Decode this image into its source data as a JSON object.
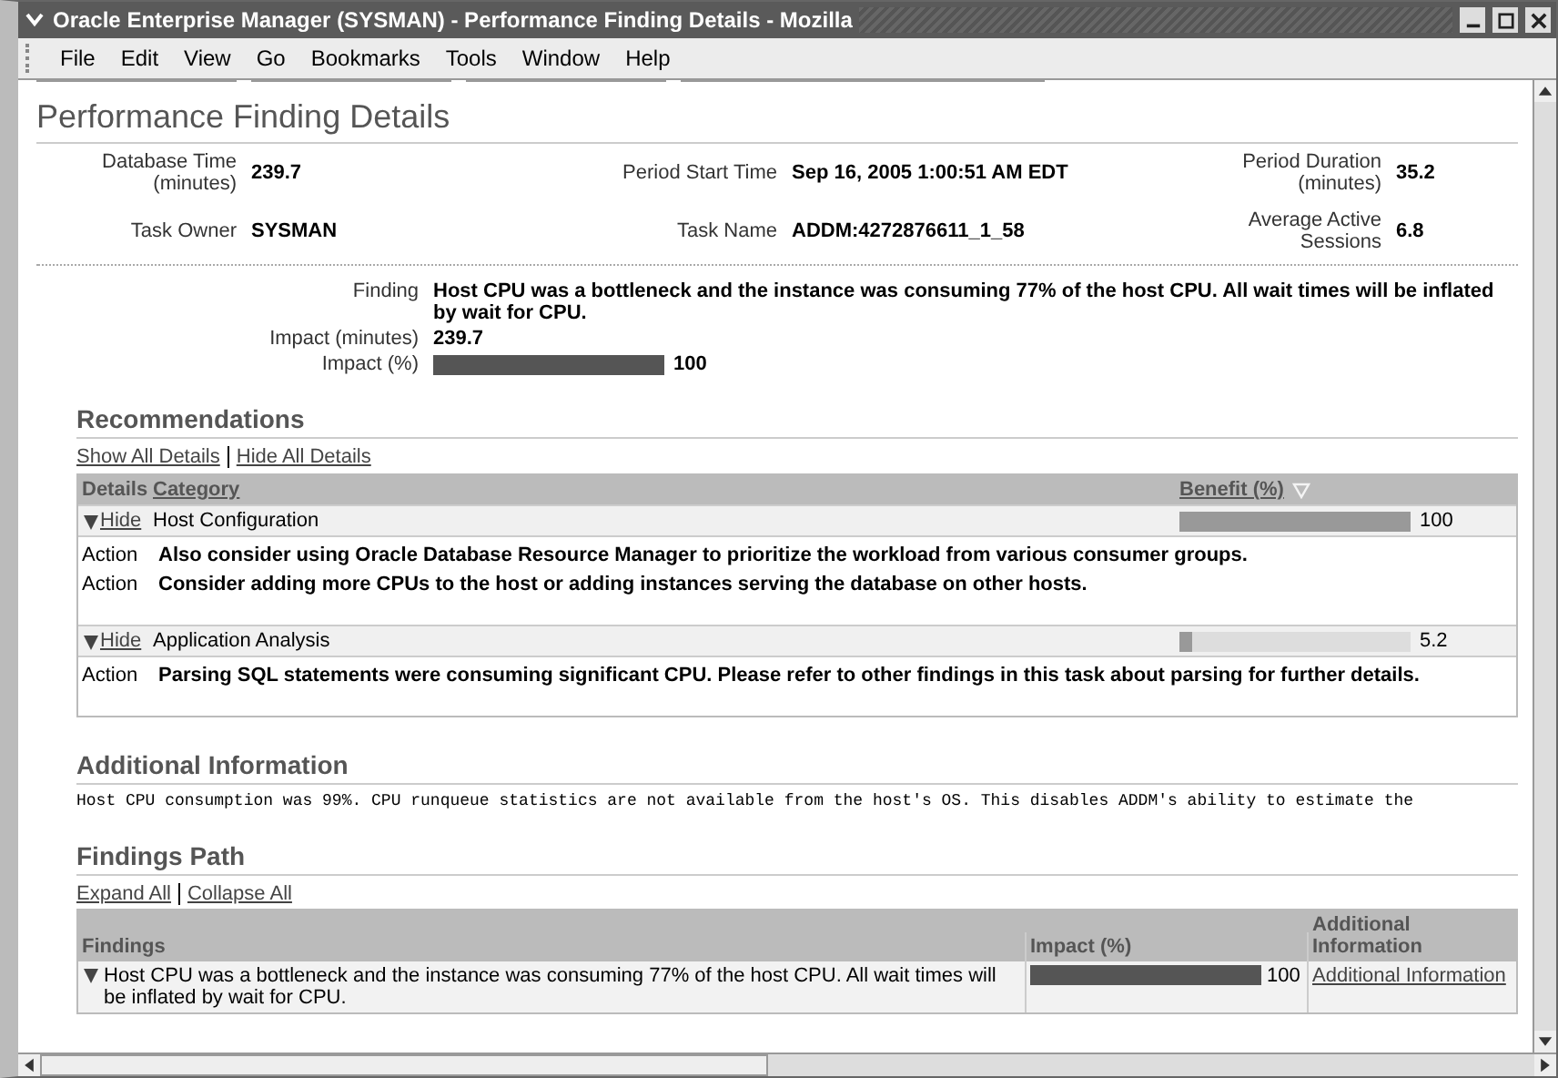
{
  "window": {
    "title": "Oracle Enterprise Manager (SYSMAN) - Performance Finding Details - Mozilla"
  },
  "menu": [
    "File",
    "Edit",
    "View",
    "Go",
    "Bookmarks",
    "Tools",
    "Window",
    "Help"
  ],
  "page_title": "Performance Finding Details",
  "summary": [
    {
      "label": "Database Time (minutes)",
      "value": "239.7"
    },
    {
      "label": "Period Start Time",
      "value": "Sep 16, 2005 1:00:51 AM EDT"
    },
    {
      "label": "Period Duration (minutes)",
      "value": "35.2"
    },
    {
      "label": "Task Owner",
      "value": "SYSMAN"
    },
    {
      "label": "Task Name",
      "value": "ADDM:4272876611_1_58"
    },
    {
      "label": "Average Active Sessions",
      "value": "6.8"
    }
  ],
  "finding": {
    "label": "Finding",
    "text": "Host CPU was a bottleneck and the instance was consuming 77% of the host CPU. All wait times will be inflated by wait for CPU.",
    "impact_minutes_label": "Impact (minutes)",
    "impact_minutes": "239.7",
    "impact_pct_label": "Impact (%)",
    "level": 1,
    "impact_pct": "100"
  },
  "recommendations": {
    "heading": "Recommendations",
    "links": [
      "Show All Details",
      "Hide All Details"
    ],
    "columns": [
      "Details",
      "Category",
      "Benefit (%)"
    ],
    "groups": [
      {
        "expanded": true,
        "toggle": "Hide",
        "category": "Host Configuration",
        "level": 1,
        "benefit": "100",
        "actions": [
          {
            "label": "Action",
            "text": "Also consider using Oracle Database Resource Manager to prioritize the workload from various consumer groups."
          },
          {
            "label": "Action",
            "text": "Consider adding more CPUs to the host or adding instances serving the database on other hosts."
          }
        ]
      },
      {
        "expanded": true,
        "toggle": "Hide",
        "category": "Application Analysis",
        "level": 0.052,
        "benefit": "5.2",
        "actions": [
          {
            "label": "Action",
            "text": "Parsing SQL statements were consuming significant CPU. Please refer to other findings in this task about parsing for further details."
          }
        ]
      }
    ]
  },
  "additional": {
    "heading": "Additional Information",
    "text": "Host CPU consumption was 99%.  CPU runqueue statistics are not available from the host's OS. This disables ADDM's ability to estimate the"
  },
  "findings_path": {
    "heading": "Findings Path",
    "links": [
      "Expand All",
      "Collapse All"
    ],
    "columns": [
      "Findings",
      "Impact (%)",
      "Additional Information"
    ],
    "rows": [
      {
        "expanded": true,
        "text": "Host CPU was a bottleneck and the instance was consuming 77% of the host CPU. All wait times will be inflated by wait for CPU.",
        "level": 1,
        "impact": "100",
        "link": "Additional Information"
      }
    ]
  }
}
